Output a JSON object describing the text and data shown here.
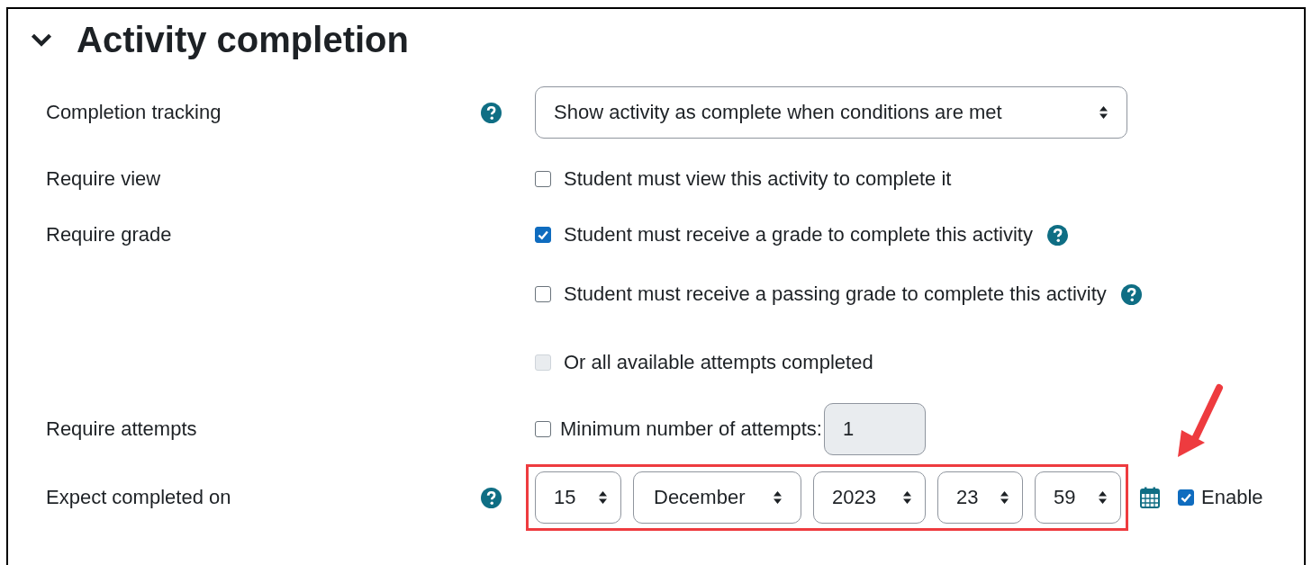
{
  "section": {
    "title": "Activity completion",
    "expanded": true
  },
  "fields": [
    {
      "kind": "select",
      "label": "Completion tracking",
      "help": true,
      "value": "Show activity as complete when conditions are met"
    },
    {
      "kind": "checks",
      "label": "Require view",
      "help": false,
      "options": [
        {
          "text": "Student must view this activity to complete it",
          "checked": false,
          "disabled": false,
          "help": false
        }
      ]
    },
    {
      "kind": "checks",
      "label": "Require grade",
      "help": false,
      "options": [
        {
          "text": "Student must receive a grade to complete this activity",
          "checked": true,
          "disabled": false,
          "help": true
        },
        {
          "text": "Student must receive a passing grade to complete this activity",
          "checked": false,
          "disabled": false,
          "help": true
        },
        {
          "text": "Or all available attempts completed",
          "checked": false,
          "disabled": true,
          "help": false
        }
      ]
    },
    {
      "kind": "number",
      "label": "Require attempts",
      "help": false,
      "check": {
        "text": "Minimum number of attempts:",
        "checked": false
      },
      "value": "1",
      "disabled": true
    },
    {
      "kind": "date",
      "label": "Expect completed on",
      "help": true,
      "highlighted": true,
      "parts": [
        "15",
        "December",
        "2023",
        "23",
        "59"
      ],
      "enable": {
        "text": "Enable",
        "checked": true
      }
    }
  ]
}
